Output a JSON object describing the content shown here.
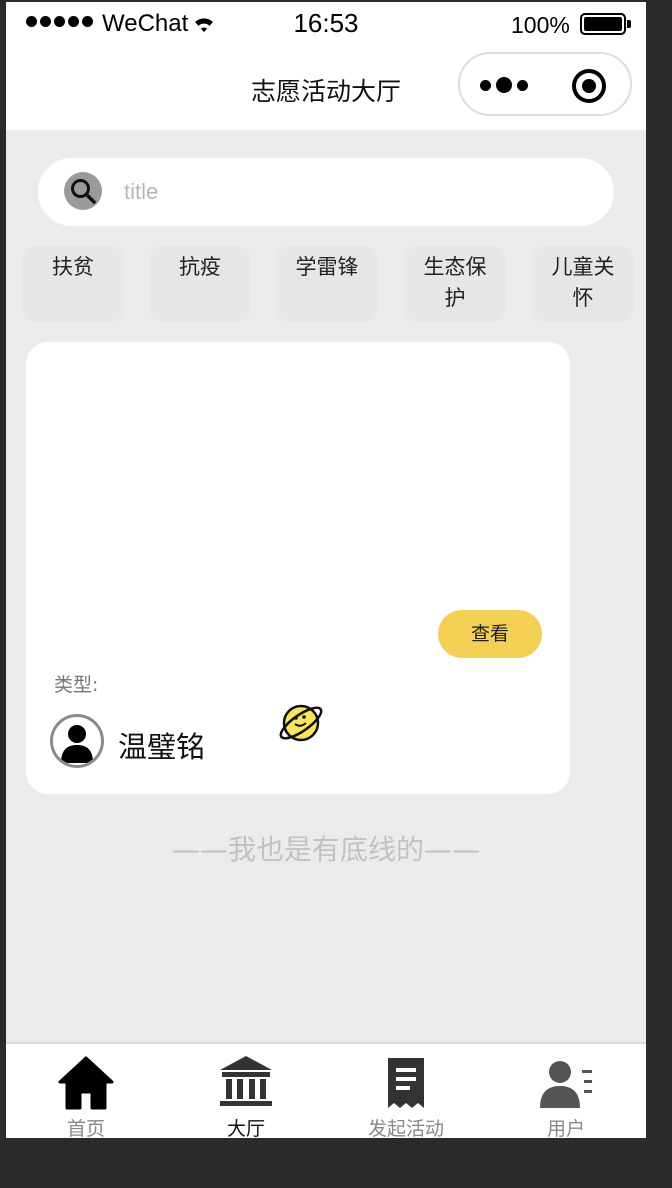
{
  "status_bar": {
    "carrier": "WeChat",
    "time": "16:53",
    "battery": "100%"
  },
  "nav": {
    "title": "志愿活动大厅"
  },
  "search": {
    "placeholder": "title",
    "value": ""
  },
  "categories": [
    {
      "label": "扶贫"
    },
    {
      "label": "抗疫"
    },
    {
      "label": "学雷锋"
    },
    {
      "label": "生态保护"
    },
    {
      "label": "儿童关怀"
    }
  ],
  "card": {
    "view_label": "查看",
    "type_label": "类型:",
    "user_name": "温璧铭"
  },
  "bottom_line": "——我也是有底线的——",
  "tabs": [
    {
      "label": "首页",
      "icon": "home-icon"
    },
    {
      "label": "大厅",
      "icon": "hall-icon"
    },
    {
      "label": "发起活动",
      "icon": "receipt-icon"
    },
    {
      "label": "用户",
      "icon": "user-list-icon"
    }
  ],
  "colors": {
    "accent": "#f3cf54",
    "page_bg": "#ebebeb",
    "card_bg": "#ffffff"
  }
}
